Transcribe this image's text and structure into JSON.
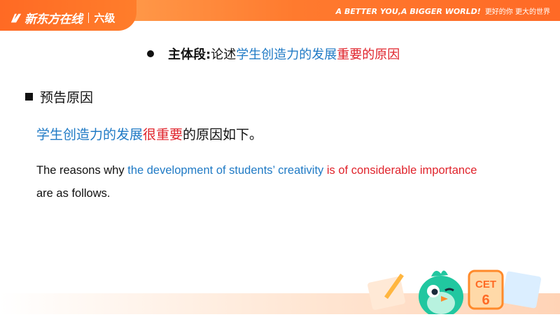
{
  "header": {
    "brand": "新东方在线",
    "course": "六级",
    "slogan_en": "A BETTER YOU,A BIGGER WORLD!",
    "slogan_cn": "更好的你 更大的世界"
  },
  "title": {
    "bold": "主体段:",
    "plain": " 论述",
    "blue": "学生创造力的发展",
    "red": "重要的原因"
  },
  "section": {
    "label": "预告原因"
  },
  "chinese": {
    "blue": "学生创造力的发展",
    "red": "很重要",
    "black": "的原因如下。"
  },
  "english": {
    "part1": "The reasons why ",
    "blue": "the development of students’ creativity",
    "mid": " ",
    "red": "is of considerable importance",
    "end": " are as follows."
  },
  "mascot": {
    "badge_line1": "CET",
    "badge_line2": "6"
  },
  "colors": {
    "brand_orange": "#ff6a24",
    "blue": "#1f7ac5",
    "red": "#e0232b"
  }
}
